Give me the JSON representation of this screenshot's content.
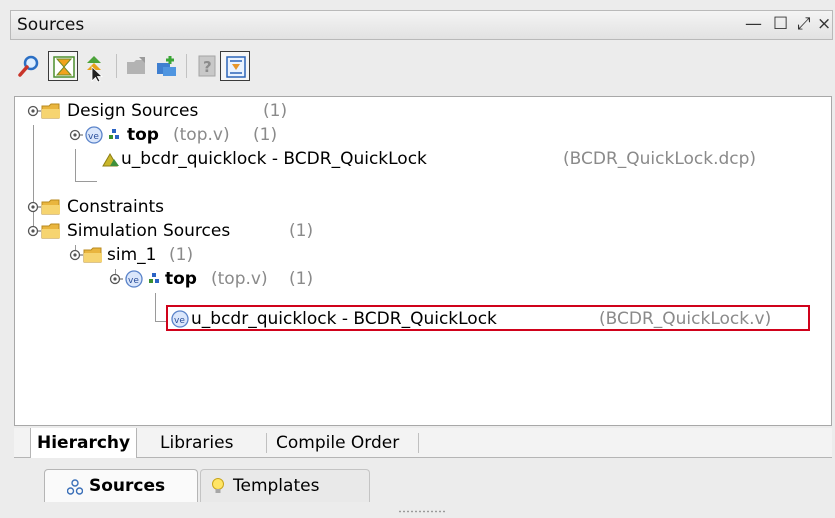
{
  "panel": {
    "title": "Sources",
    "controls": {
      "minimize": "—",
      "maximize": "☐",
      "float": "⤢",
      "close": "×"
    }
  },
  "toolbar": {
    "buttons": [
      {
        "icon": "search-icon",
        "pressed": false
      },
      {
        "icon": "collapse-all-icon",
        "pressed": true
      },
      {
        "icon": "expand-all-icon",
        "pressed": false
      },
      {
        "icon": "open-folder-icon",
        "pressed": false,
        "disabled": true
      },
      {
        "icon": "add-sources-icon",
        "pressed": false
      },
      {
        "icon": "properties-icon",
        "pressed": false,
        "disabled": true
      },
      {
        "icon": "auto-update-icon",
        "pressed": true
      }
    ]
  },
  "tree": {
    "design_sources": {
      "label": "Design Sources",
      "count": "(1)"
    },
    "design_top": {
      "label": "top",
      "file": "(top.v)",
      "count": "(1)"
    },
    "design_inst": {
      "label": "u_bcdr_quicklock - BCDR_QuickLock",
      "file": "(BCDR_QuickLock.dcp)"
    },
    "constraints": {
      "label": "Constraints"
    },
    "sim_sources": {
      "label": "Simulation Sources",
      "count": "(1)"
    },
    "sim_1": {
      "label": "sim_1",
      "count": "(1)"
    },
    "sim_top": {
      "label": "top",
      "file": "(top.v)",
      "count": "(1)"
    },
    "sim_inst": {
      "label": "u_bcdr_quicklock - BCDR_QuickLock",
      "file": "(BCDR_QuickLock.v)"
    }
  },
  "view_tabs": [
    {
      "label": "Hierarchy",
      "active": true
    },
    {
      "label": "Libraries",
      "active": false
    },
    {
      "label": "Compile Order",
      "active": false
    }
  ],
  "panel_tabs": [
    {
      "label": "Sources",
      "active": true,
      "icon": "sources-icon"
    },
    {
      "label": "Templates",
      "active": false,
      "icon": "lightbulb-icon"
    }
  ],
  "colors": {
    "folder": "#f2c24b",
    "verilog_badge": "#5a83c9",
    "selection_border": "#d0021b",
    "gray_text": "#8a8a8a"
  }
}
